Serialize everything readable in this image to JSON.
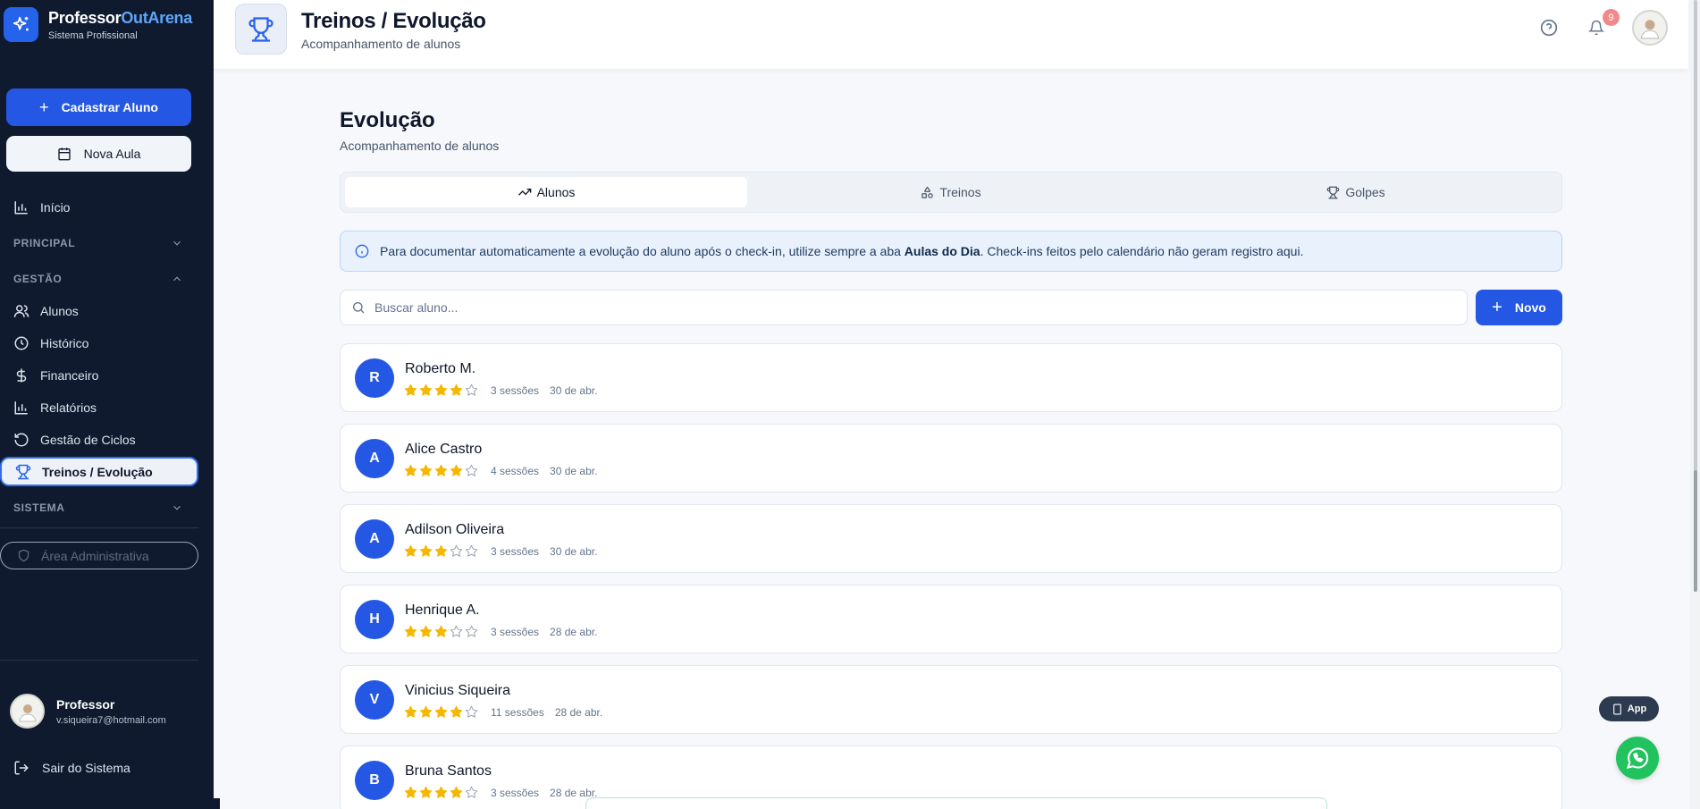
{
  "brand": {
    "name_part1": "Professor",
    "name_part2": "OutArena",
    "subtitle": "Sistema Profissional"
  },
  "sidebar": {
    "cadastrar_label": "Cadastrar Aluno",
    "nova_aula_label": "Nova Aula",
    "inicio_label": "Início",
    "section_principal": "PRINCIPAL",
    "section_gestao": "GESTÃO",
    "items": [
      {
        "label": "Alunos",
        "icon": "users-icon"
      },
      {
        "label": "Histórico",
        "icon": "clock-icon"
      },
      {
        "label": "Financeiro",
        "icon": "dollar-icon"
      },
      {
        "label": "Relatórios",
        "icon": "bar-chart-icon"
      },
      {
        "label": "Gestão de Ciclos",
        "icon": "rotate-icon"
      },
      {
        "label": "Treinos / Evolução",
        "icon": "trophy-icon",
        "active": true
      }
    ],
    "section_sistema": "SISTEMA",
    "admin_label": "Área Administrativa",
    "user_name": "Professor",
    "user_email": "v.siqueira7@hotmail.com",
    "logout_label": "Sair do Sistema"
  },
  "header": {
    "title": "Treinos / Evolução",
    "subtitle": "Acompanhamento de alunos",
    "notification_count": "9"
  },
  "main": {
    "title": "Evolução",
    "subtitle": "Acompanhamento de alunos",
    "tabs": [
      {
        "label": "Alunos",
        "active": true
      },
      {
        "label": "Treinos",
        "active": false
      },
      {
        "label": "Golpes",
        "active": false
      }
    ],
    "info_text_1": "Para documentar automaticamente a evolução do aluno após o check-in, utilize sempre a aba ",
    "info_bold": "Aulas do Dia",
    "info_text_2": ". Check-ins feitos pelo calendário não geram registro aqui.",
    "search_placeholder": "Buscar aluno...",
    "novo_label": "Novo",
    "students": [
      {
        "initial": "R",
        "name": "Roberto M.",
        "rating": 4,
        "sessions": "3 sessões",
        "date": "30 de abr."
      },
      {
        "initial": "A",
        "name": "Alice Castro",
        "rating": 4,
        "sessions": "4 sessões",
        "date": "30 de abr."
      },
      {
        "initial": "A",
        "name": "Adilson Oliveira",
        "rating": 3,
        "sessions": "3 sessões",
        "date": "30 de abr."
      },
      {
        "initial": "H",
        "name": "Henrique A.",
        "rating": 3,
        "sessions": "3 sessões",
        "date": "28 de abr."
      },
      {
        "initial": "V",
        "name": "Vinicius Siqueira",
        "rating": 4,
        "sessions": "11 sessões",
        "date": "28 de abr."
      },
      {
        "initial": "B",
        "name": "Bruna Santos",
        "rating": 4,
        "sessions": "3 sessões",
        "date": "28 de abr."
      }
    ]
  },
  "floating": {
    "app_label": "App"
  },
  "colors": {
    "accent": "#2557e5",
    "sidebar_bg": "#0f1a2e",
    "star": "#f5b700",
    "whatsapp": "#22c35e"
  }
}
